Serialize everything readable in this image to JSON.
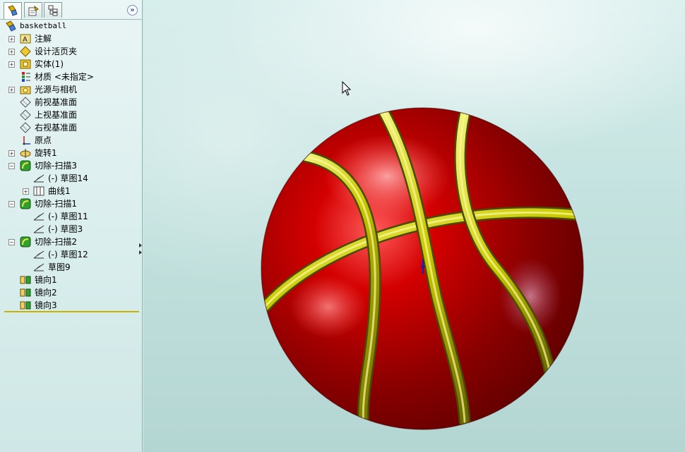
{
  "tabs": [
    {
      "name": "feature-manager",
      "icon": "feature-tree-icon"
    },
    {
      "name": "property-manager",
      "icon": "property-manager-icon"
    },
    {
      "name": "configuration-manager",
      "icon": "configuration-manager-icon"
    }
  ],
  "expand_icon": "double-chevron-right-icon",
  "tree": {
    "root": "basketball",
    "items": [
      {
        "label": "注解",
        "icon": "annotations-icon",
        "indent": 0,
        "expander": "+"
      },
      {
        "label": "设计活页夹",
        "icon": "design-binder-icon",
        "indent": 0,
        "expander": "+"
      },
      {
        "label": "实体(1)",
        "icon": "solid-bodies-icon",
        "indent": 0,
        "expander": "+"
      },
      {
        "label": "材质 <未指定>",
        "icon": "material-icon",
        "indent": 0,
        "expander": ""
      },
      {
        "label": "光源与相机",
        "icon": "lights-cameras-icon",
        "indent": 0,
        "expander": "+"
      },
      {
        "label": "前视基准面",
        "icon": "plane-icon",
        "indent": 0,
        "expander": ""
      },
      {
        "label": "上视基准面",
        "icon": "plane-icon",
        "indent": 0,
        "expander": ""
      },
      {
        "label": "右视基准面",
        "icon": "plane-icon",
        "indent": 0,
        "expander": ""
      },
      {
        "label": "原点",
        "icon": "origin-icon",
        "indent": 0,
        "expander": ""
      },
      {
        "label": "旋转1",
        "icon": "revolve-icon",
        "indent": 0,
        "expander": "+"
      },
      {
        "label": "切除-扫描3",
        "icon": "cut-sweep-icon",
        "indent": 0,
        "expander": "-"
      },
      {
        "label": "(-) 草图14",
        "icon": "sketch-icon",
        "indent": 1,
        "expander": ""
      },
      {
        "label": "曲线1",
        "icon": "curve-icon",
        "indent": 1,
        "expander": "+"
      },
      {
        "label": "切除-扫描1",
        "icon": "cut-sweep-icon",
        "indent": 0,
        "expander": "-"
      },
      {
        "label": "(-) 草图11",
        "icon": "sketch-icon",
        "indent": 1,
        "expander": ""
      },
      {
        "label": "(-) 草图3",
        "icon": "sketch-icon",
        "indent": 1,
        "expander": ""
      },
      {
        "label": "切除-扫描2",
        "icon": "cut-sweep-icon",
        "indent": 0,
        "expander": "-"
      },
      {
        "label": "(-) 草图12",
        "icon": "sketch-icon",
        "indent": 1,
        "expander": ""
      },
      {
        "label": "草图9",
        "icon": "sketch-icon",
        "indent": 1,
        "expander": ""
      },
      {
        "label": "镜向1",
        "icon": "mirror-icon",
        "indent": 0,
        "expander": ""
      },
      {
        "label": "镜向2",
        "icon": "mirror-icon",
        "indent": 0,
        "expander": ""
      },
      {
        "label": "镜向3",
        "icon": "mirror-icon",
        "indent": 0,
        "expander": ""
      }
    ]
  },
  "model": {
    "name": "basketball",
    "body_color": "#b00000",
    "seam_color": "#c8c800",
    "background_color": "#c6e3e0"
  },
  "cursor_icon": "mouse-pointer-icon"
}
